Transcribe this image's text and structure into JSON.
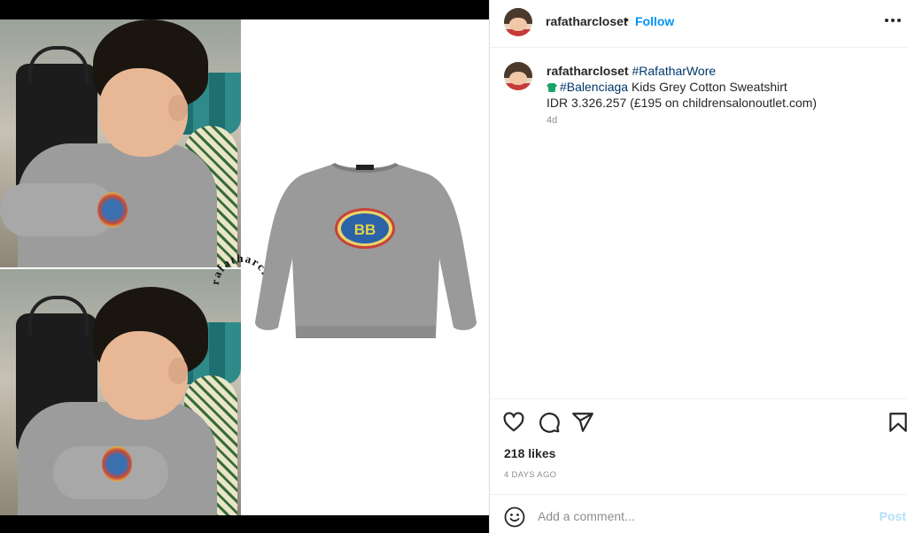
{
  "header": {
    "username": "rafatharcloset",
    "separator": "•",
    "follow_label": "Follow",
    "more_label": "•••"
  },
  "caption": {
    "username": "rafatharcloset",
    "hashtag": "#RafatharWore",
    "brand_tag": "#Balenciaga",
    "product_name": "Kids Grey Cotton Sweatshirt",
    "price_line": "IDR 3.326.257 (£195 on childrensalonoutlet.com)",
    "time": "4d"
  },
  "media": {
    "watermark_text": "rafatharcloset",
    "product_logo_text": "BB"
  },
  "actions": {
    "likes": "218 likes",
    "date": "4 DAYS AGO"
  },
  "comment": {
    "placeholder": "Add a comment...",
    "post_label": "Post"
  },
  "colors": {
    "link_blue": "#0095f6",
    "hashtag": "#00376b",
    "post_disabled": "#b2dffc"
  }
}
